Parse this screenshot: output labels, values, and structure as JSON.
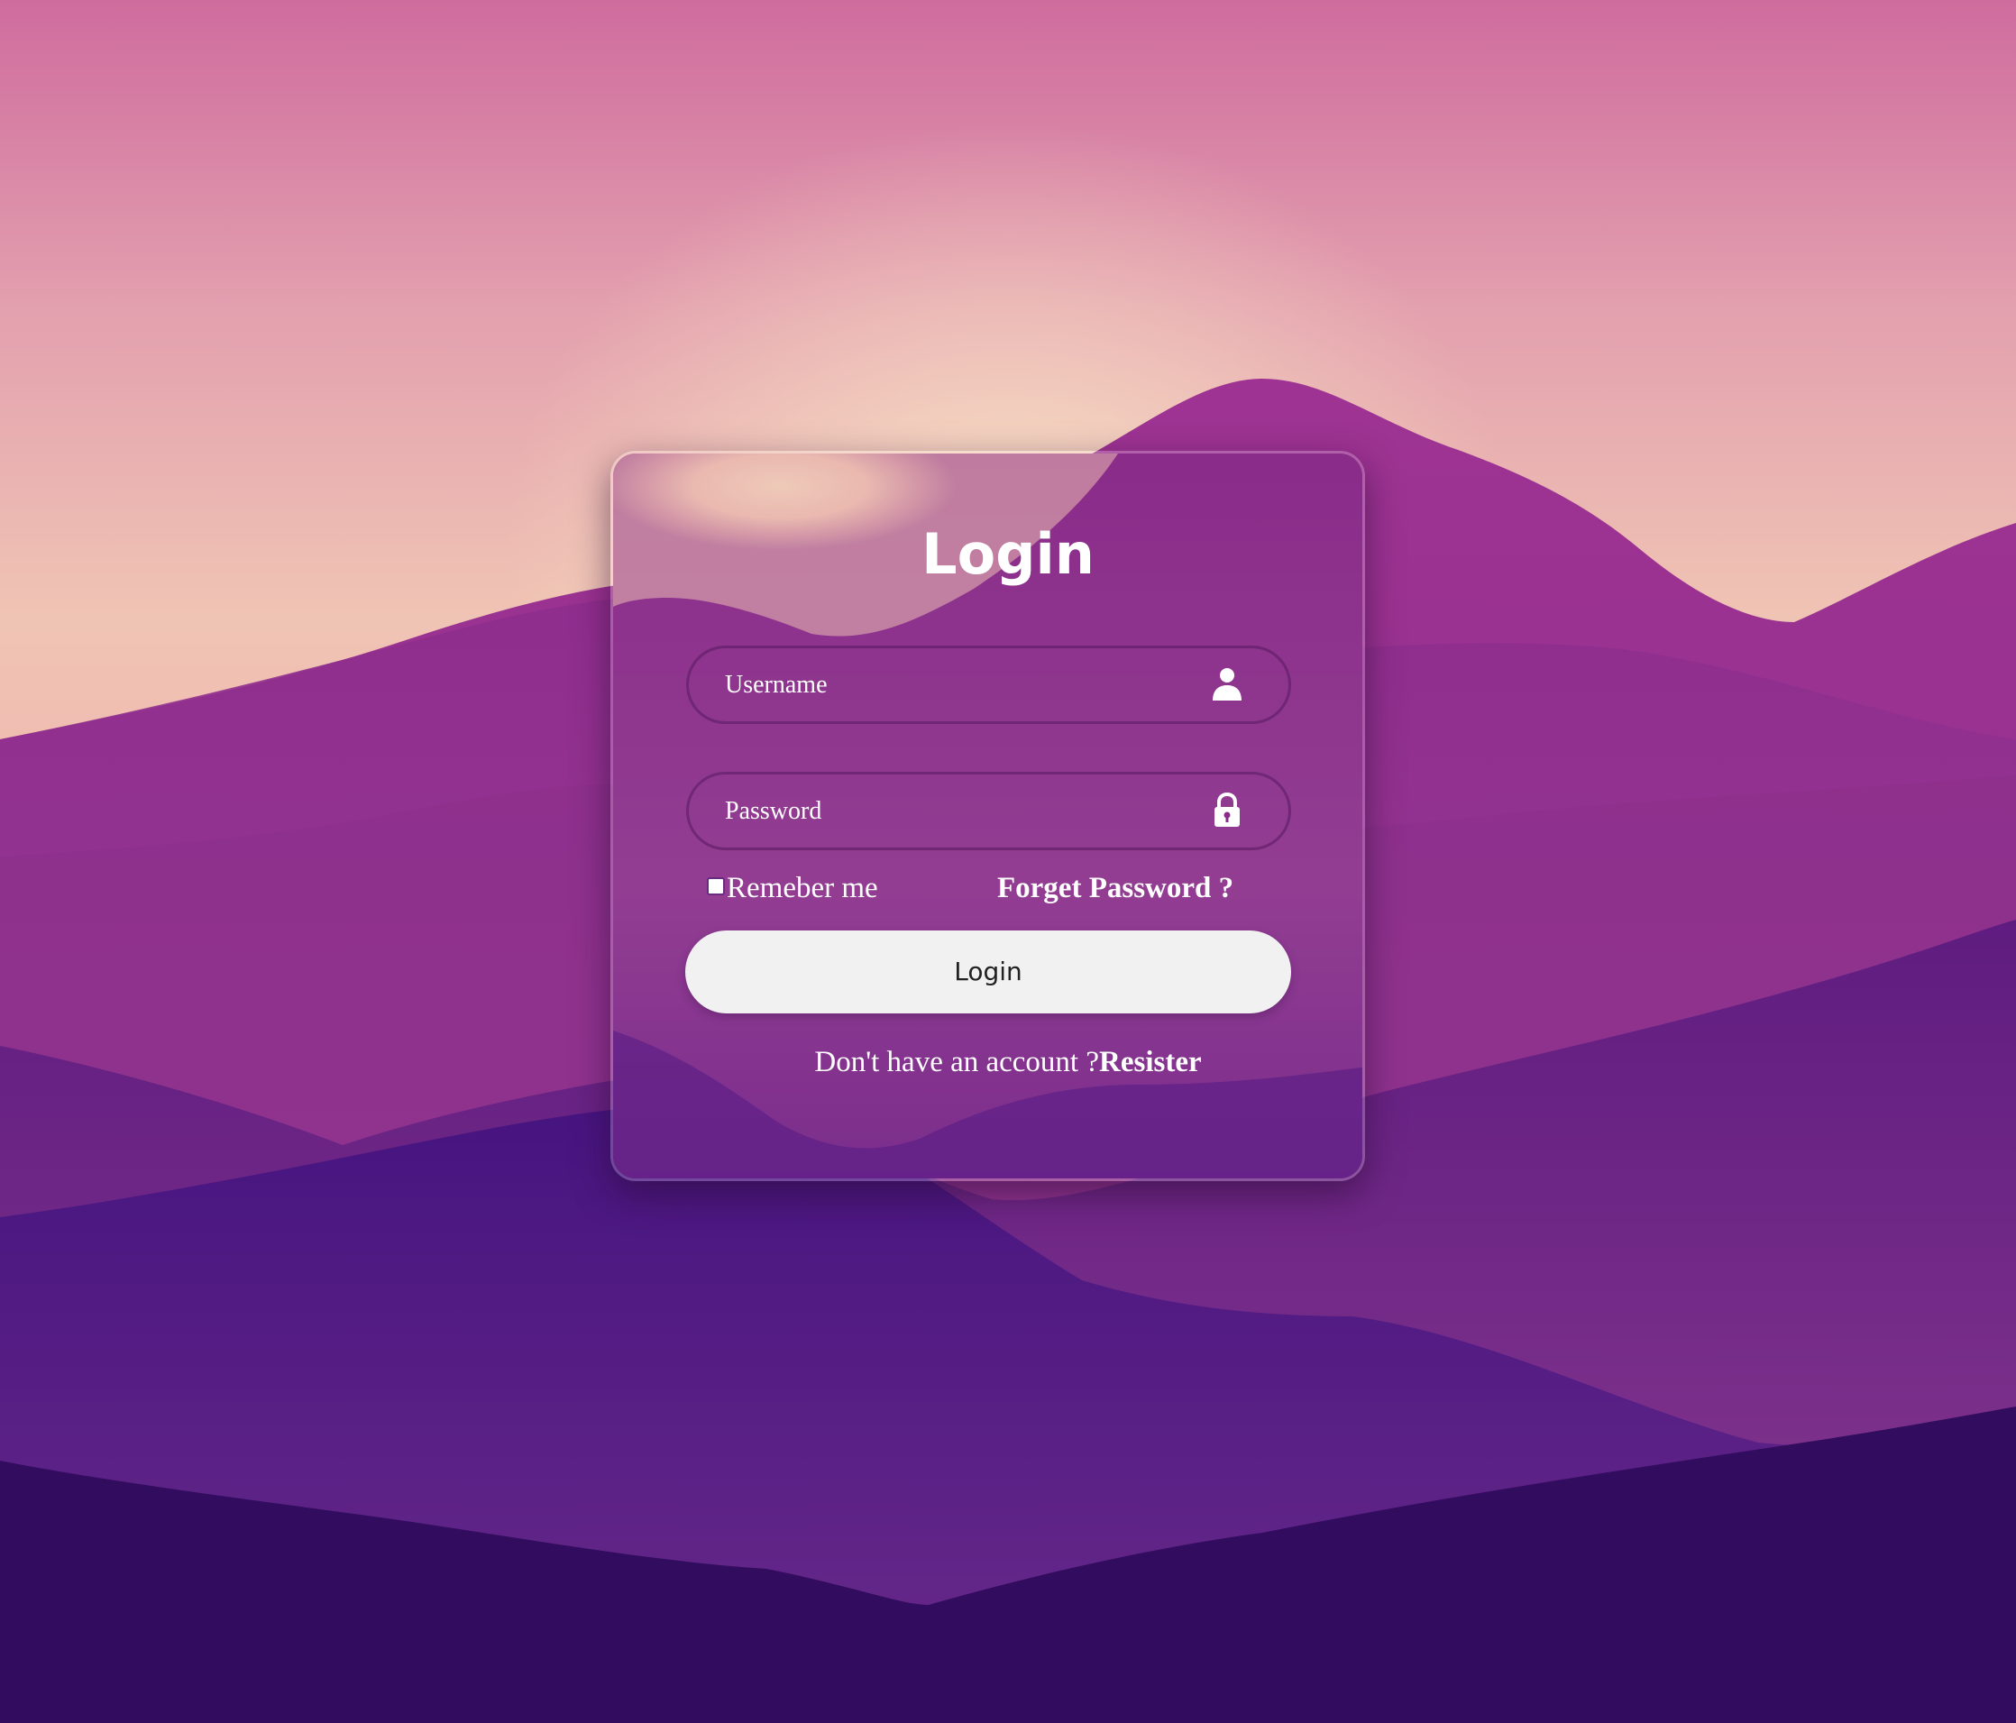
{
  "form": {
    "title": "Login",
    "username": {
      "placeholder": "Username",
      "icon": "user-icon"
    },
    "password": {
      "placeholder": "Password",
      "icon": "lock-icon"
    },
    "remember_label": "Remeber me",
    "remember_checked": false,
    "forgot_label": "Forget Password ?",
    "submit_label": "Login",
    "register_prompt": "Don't have an account ?",
    "register_link": "Resister"
  },
  "colors": {
    "sky_top": "#d06a9c",
    "sky_glow": "#f5dcc0",
    "mountain_purple": "#872b8a",
    "mountain_dark": "#320c5e",
    "button_bg": "#f1f1f1",
    "text_light": "#ffffff"
  }
}
